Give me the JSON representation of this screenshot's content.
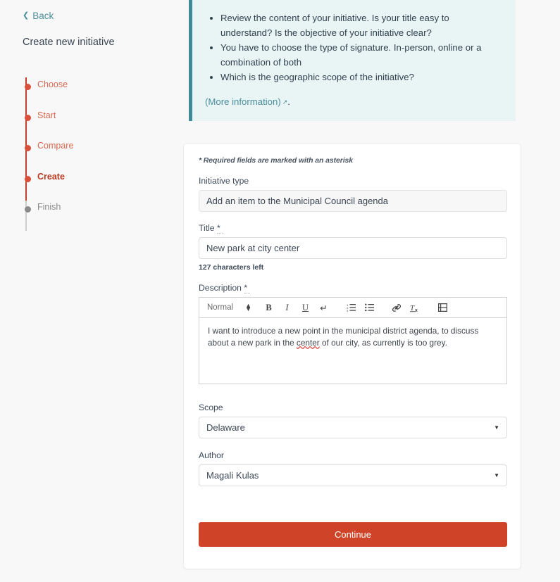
{
  "sidebar": {
    "back_label": "Back",
    "back_icon": "chevron-left-icon",
    "title": "Create new initiative",
    "steps": [
      {
        "label": "Choose",
        "state": "done"
      },
      {
        "label": "Start",
        "state": "done"
      },
      {
        "label": "Compare",
        "state": "done"
      },
      {
        "label": "Create",
        "state": "current"
      },
      {
        "label": "Finish",
        "state": "pending"
      }
    ]
  },
  "callout": {
    "bullets": [
      "Review the content of your initiative. Is your title easy to understand? Is the objective of your initiative clear?",
      "You have to choose the type of signature. In-person, online or a combination of both",
      "Which is the geographic scope of the initiative?"
    ],
    "more_link": "(More information)",
    "more_link_icon": "external-link-icon",
    "trailing_text": "."
  },
  "form": {
    "required_note": "* Required fields are marked with an asterisk",
    "initiative_type": {
      "label": "Initiative type",
      "value": "Add an item to the Municipal Council agenda"
    },
    "title": {
      "label": "Title",
      "required_marker": "*",
      "value": "New park at city center",
      "char_counter": "127 characters left"
    },
    "description": {
      "label": "Description",
      "required_marker": "*",
      "value": "I want to introduce a new point in the municipal district agenda, to discuss about a new park in the ",
      "misspelled_word": "center",
      "value_rest": " of our city, as currently is too grey.",
      "toolbar": {
        "format_label": "Normal",
        "buttons": [
          "bold-icon",
          "italic-icon",
          "underline-icon",
          "line-break-icon",
          "ordered-list-icon",
          "bullet-list-icon",
          "link-icon",
          "clear-format-icon",
          "video-embed-icon"
        ]
      }
    },
    "scope": {
      "label": "Scope",
      "value": "Delaware"
    },
    "author": {
      "label": "Author",
      "value": "Magali Kulas"
    },
    "submit_label": "Continue"
  },
  "colors": {
    "accent_red": "#cf4429",
    "step_red": "#d9503a",
    "link_teal": "#4b8f9c",
    "callout_bg": "#e9f4f5",
    "callout_border": "#3f8a99",
    "page_bg": "#f8f8f8"
  }
}
